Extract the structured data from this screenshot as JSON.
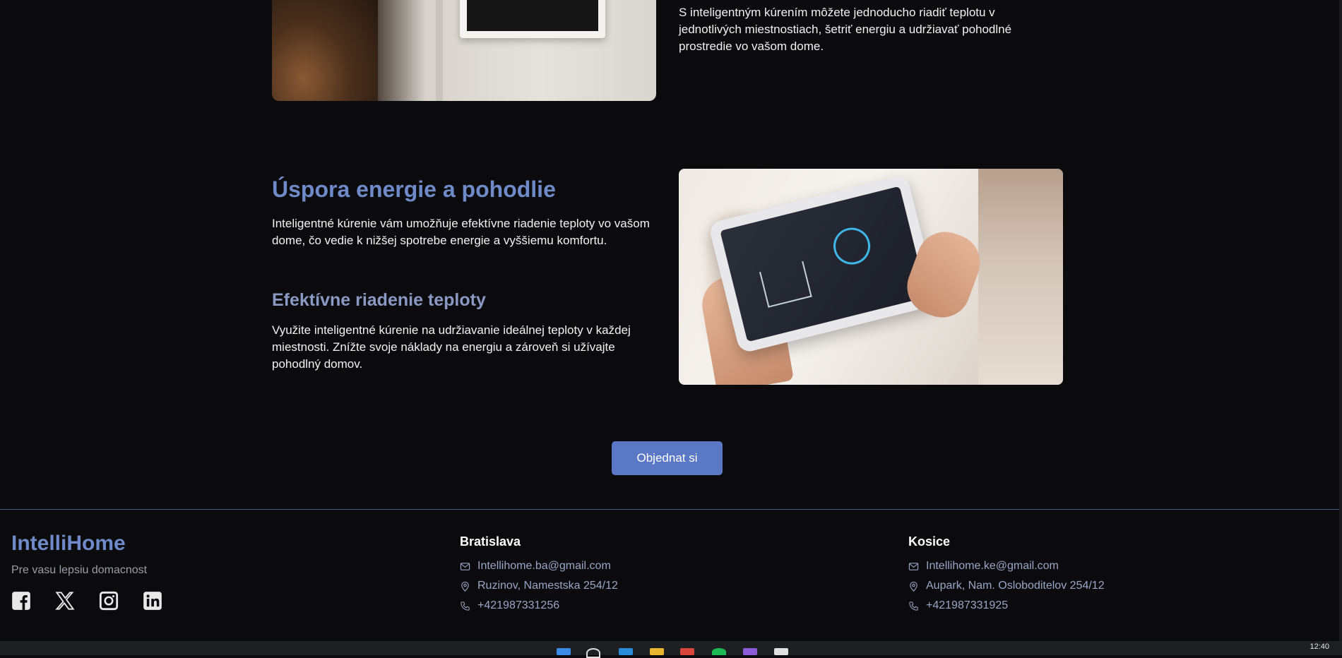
{
  "section_top": {
    "text": "S inteligentným kúrením môžete jednoducho riadiť teplotu v jednotlivých miestnostiach, šetriť energiu a udržiavať pohodlné prostredie vo vašom dome."
  },
  "section_main": {
    "heading": "Úspora energie a pohodlie",
    "paragraph": "Inteligentné kúrenie vám umožňuje efektívne riadenie teploty vo vašom dome, čo vedie k nižšej spotrebe energie a vyššiemu komfortu.",
    "subheading": "Efektívne riadenie teploty",
    "subparagraph": "Využite inteligentné kúrenie na udržiavanie ideálnej teploty v každej miestnosti. Znížte svoje náklady na energiu a zároveň si užívajte pohodlný domov."
  },
  "cta": {
    "label": "Objednat si"
  },
  "footer": {
    "brand": "IntelliHome",
    "tagline": "Pre vasu lepsiu domacnost",
    "socials": [
      "facebook-icon",
      "x-icon",
      "instagram-icon",
      "linkedin-icon"
    ],
    "bratislava": {
      "title": "Bratislava",
      "email": "Intellihome.ba@gmail.com",
      "address": "Ruzinov, Namestska 254/12",
      "phone": "+421987331256"
    },
    "kosice": {
      "title": "Kosice",
      "email": "Intellihome.ke@gmail.com",
      "address": "Aupark, Nam. Osloboditelov 254/12",
      "phone": "+421987331925"
    }
  },
  "taskbar": {
    "clock": "12:40"
  },
  "colors": {
    "background": "#0b0b0d",
    "accent": "#6e8ac8",
    "button": "#5a78c6",
    "footer_line": "#3e5a8a"
  }
}
